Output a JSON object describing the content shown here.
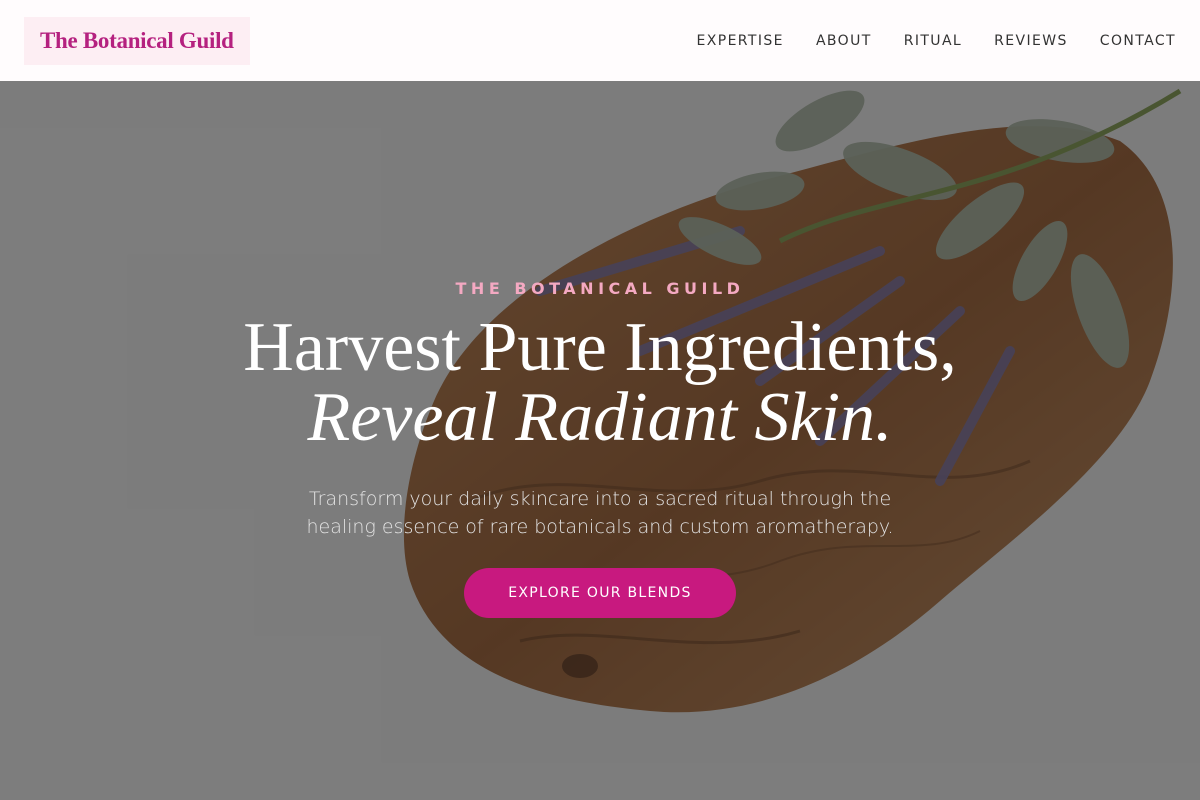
{
  "header": {
    "logo": "The Botanical Guild",
    "nav": [
      "EXPERTISE",
      "ABOUT",
      "RITUAL",
      "REVIEWS",
      "CONTACT"
    ]
  },
  "hero": {
    "eyebrow": "THE BOTANICAL GUILD",
    "headline_line1": "Harvest Pure Ingredients,",
    "headline_line2": "Reveal Radiant Skin.",
    "subtext": "Transform your daily skincare into a sacred ritual through the healing essence of rare botanicals and custom aromatherapy.",
    "cta": "EXPLORE OUR BLENDS"
  },
  "colors": {
    "brand": "#b5217f",
    "cta": "#c8197f",
    "eyebrow": "#f4a9c2",
    "logo_bg": "#fdeef3"
  }
}
